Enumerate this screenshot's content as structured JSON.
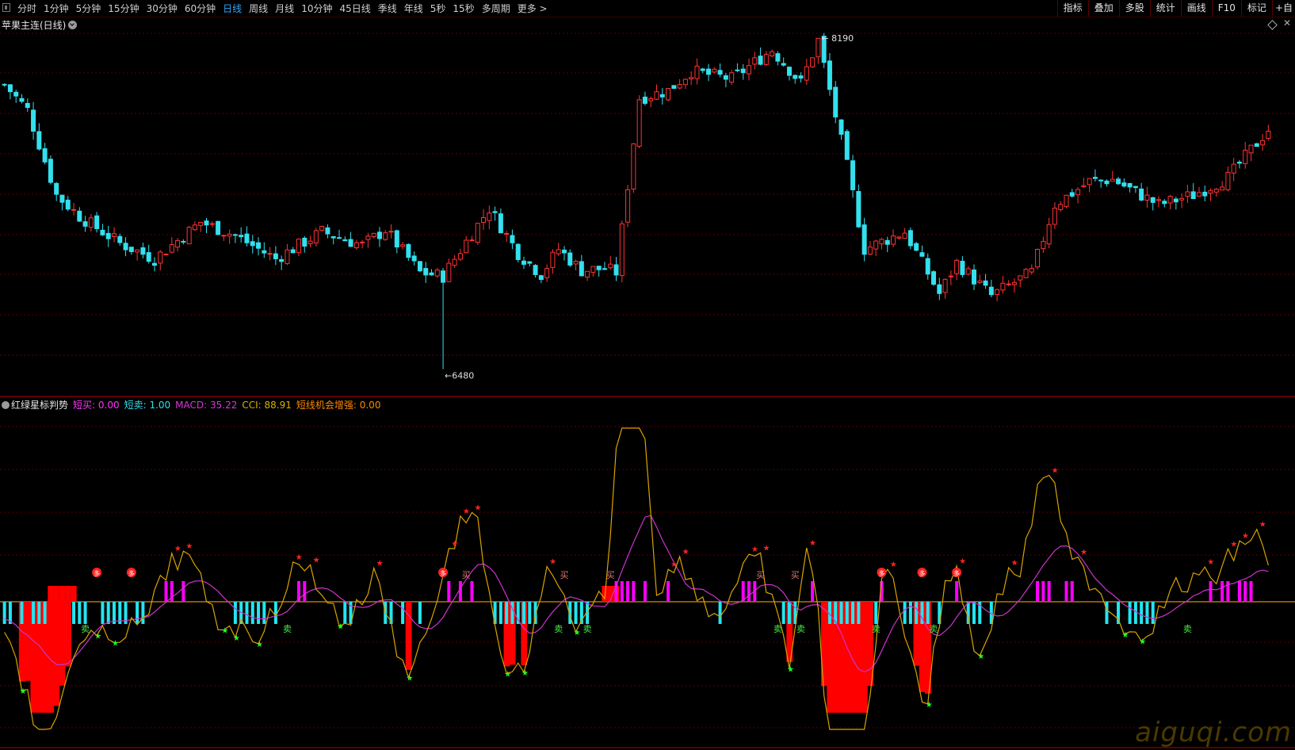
{
  "toolbar": {
    "periods": [
      "分时",
      "1分钟",
      "5分钟",
      "15分钟",
      "30分钟",
      "60分钟",
      "日线",
      "周线",
      "月线",
      "10分钟",
      "45日线",
      "季线",
      "年线",
      "5秒",
      "15秒",
      "多周期",
      "更多 >"
    ],
    "active_period": "日线",
    "tools": [
      "指标",
      "叠加",
      "多股",
      "统计",
      "画线",
      "F10",
      "标记",
      "+自"
    ]
  },
  "main": {
    "title": "苹果主连(日线)",
    "high_label": "8190",
    "low_label": "6480"
  },
  "sub": {
    "name": "红绿星标判势",
    "values": [
      {
        "label": "短买: ",
        "value": "0.00",
        "color": "#ff33ff"
      },
      {
        "label": "短卖: ",
        "value": "1.00",
        "color": "#33ddee"
      },
      {
        "label": "MACD: ",
        "value": "35.22",
        "color": "#dd33dd"
      },
      {
        "label": "CCI: ",
        "value": "88.91",
        "color": "#d9b000"
      },
      {
        "label": "短线机会增强: ",
        "value": "0.00",
        "color": "#ff8800"
      }
    ],
    "marker_buy_text": "买",
    "marker_sell_text": "卖",
    "marker_circle_text": "多"
  },
  "watermark": "aiguqi.com",
  "colors": {
    "up": "#ff3333",
    "down": "#33e0ee",
    "grid": "#5a0000",
    "bull_bar": "#ff00ff",
    "bear_bar": "#22e6f0",
    "red_area": "#ff0000",
    "macd_line": "#cc33cc",
    "cci_line": "#d9a300",
    "star_up": "#ff2222",
    "star_down": "#22ff22",
    "zero_line": "#d98c00"
  },
  "chart_data": {
    "type": "candlestick",
    "price_range": [
      6380,
      8240
    ],
    "price_high": 8190,
    "price_low": 6480,
    "candle_count": 220,
    "indicator": "红绿星标判势",
    "indicator_values": {
      "短买": 0.0,
      "短卖": 1.0,
      "MACD": 35.22,
      "CCI": 88.91,
      "短线机会增强": 0.0
    }
  }
}
